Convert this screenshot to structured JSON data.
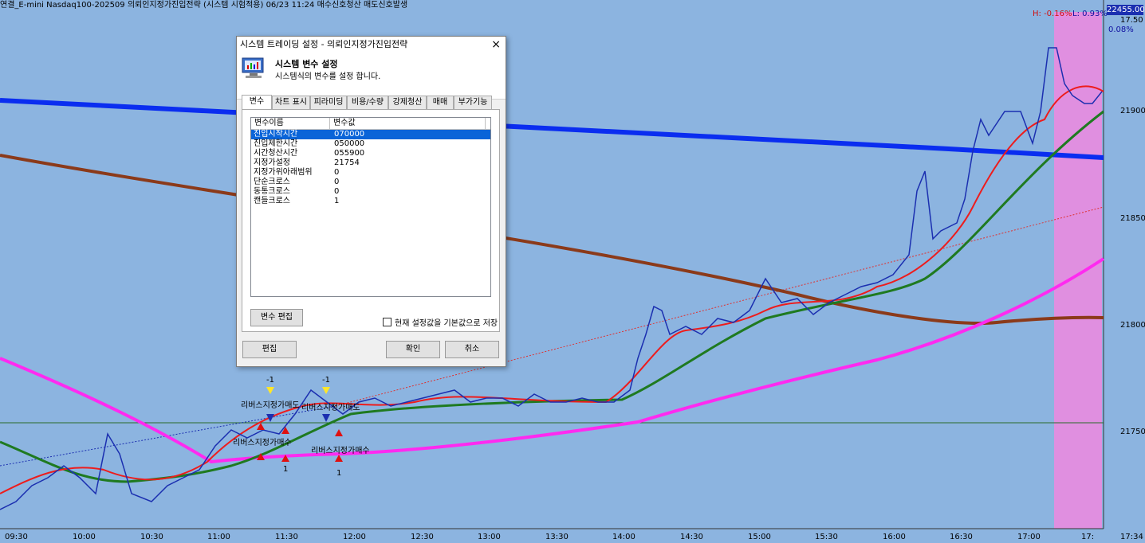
{
  "topbar": {
    "title": "연결_E-mini Nasdaq100-202509 의뢰인지정가진입전략 (시스템 시험적용) 06/23 11:24 매수신호청산 매도신호발생"
  },
  "readouts": {
    "high": "H: -0.16%",
    "low": "L: 0.93%",
    "pct": "0.08%",
    "price_box": "22455.00",
    "price_small": "17.50"
  },
  "y_axis": {
    "labels": [
      "21900.00",
      "21850.00",
      "21800.00",
      "21750.00"
    ]
  },
  "x_axis": {
    "labels": [
      "09:30",
      "10:00",
      "10:30",
      "11:00",
      "11:30",
      "12:00",
      "12:30",
      "13:00",
      "13:30",
      "14:00",
      "14:30",
      "15:00",
      "15:30",
      "16:00",
      "16:30",
      "17:00",
      "17:",
      "17:34"
    ]
  },
  "annotations": {
    "sell_label": "리버스지정가매도",
    "buy_label": "리버스지정가매수",
    "minus_one": "-1",
    "one": "1"
  },
  "dialog": {
    "title": "시스템 트레이딩 설정 - 의뢰인지정가진입전략",
    "close": "×",
    "header_title": "시스템 변수 설정",
    "header_sub": "시스템식의 변수를 설정 합니다.",
    "tabs": [
      "변수",
      "차트 표시",
      "피라미딩",
      "비용/수량",
      "강제청산",
      "매매",
      "부가기능"
    ],
    "list_headers": [
      "변수이름",
      "변수값"
    ],
    "rows": [
      {
        "name": "진입시작시간",
        "value": "070000"
      },
      {
        "name": "진입제한시간",
        "value": "050000"
      },
      {
        "name": "시간청산시간",
        "value": "055900"
      },
      {
        "name": "지정가설정",
        "value": "21754"
      },
      {
        "name": "지정가위아래범위",
        "value": "0"
      },
      {
        "name": "단순크로스",
        "value": "0"
      },
      {
        "name": "동통크로스",
        "value": "0"
      },
      {
        "name": "캔들크로스",
        "value": "1"
      }
    ],
    "edit_var_btn": "변수 편집",
    "save_default": "현재 설정값을 기본값으로 저장",
    "edit_btn": "편집",
    "ok_btn": "확인",
    "cancel_btn": "취소"
  },
  "colors": {
    "bg": "#8cb4e0",
    "blue_ma": "#0a2df0",
    "brown_ma": "#8b3a1a",
    "magenta_ma": "#ff2af0",
    "green_ma": "#1f7a20",
    "red_ma": "#ee1c1c",
    "price": "#1b2fb0",
    "highlight": "#e08fe0"
  }
}
